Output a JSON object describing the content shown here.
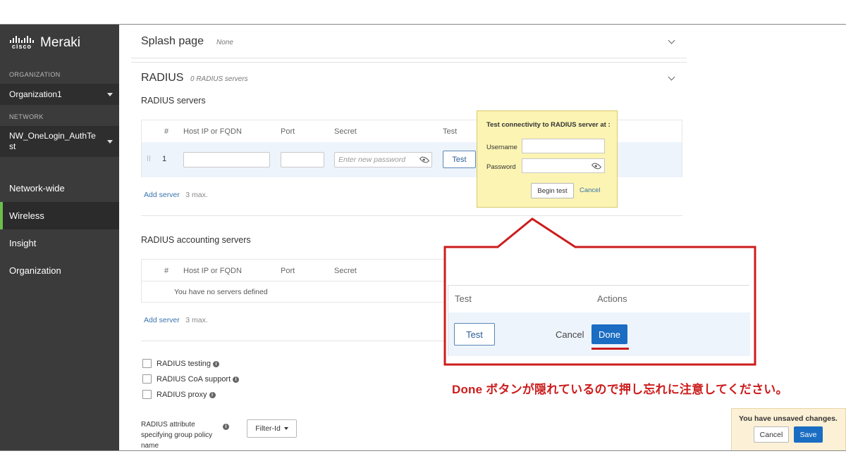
{
  "sidebar": {
    "logo_cisco": "cisco",
    "logo_product": "Meraki",
    "org_label": "ORGANIZATION",
    "org_value": "Organization1",
    "network_label": "NETWORK",
    "network_value": "NW_OneLogin_AuthTest",
    "nav": [
      "Network-wide",
      "Wireless",
      "Insight",
      "Organization"
    ],
    "active_nav": "Wireless",
    "accent": "#6abf4b"
  },
  "splash": {
    "title": "Splash page",
    "value": "None"
  },
  "radius": {
    "title": "RADIUS",
    "count": "0 RADIUS servers",
    "servers_heading": "RADIUS servers",
    "columns": [
      "#",
      "Host IP or FQDN",
      "Port",
      "Secret",
      "Test"
    ],
    "row_number": "1",
    "secret_placeholder": "Enter new password",
    "test_button": "Test",
    "add_server": "Add server",
    "max_note": "3 max.",
    "accounting_heading": "RADIUS accounting servers",
    "accounting_columns": [
      "#",
      "Host IP or FQDN",
      "Port",
      "Secret"
    ],
    "empty_message": "You have no servers defined",
    "options": [
      "RADIUS testing",
      "RADIUS CoA support",
      "RADIUS proxy"
    ],
    "attribute_label": "RADIUS attribute specifying group policy name",
    "attribute_value": "Filter-Id"
  },
  "test_popup": {
    "title": "Test connectivity to RADIUS server at :",
    "username_label": "Username",
    "password_label": "Password",
    "begin_button": "Begin test",
    "cancel_link": "Cancel"
  },
  "callout": {
    "col_test": "Test",
    "col_actions": "Actions",
    "test_button": "Test",
    "cancel_button": "Cancel",
    "done_button": "Done",
    "note": "Done ボタンが隠れているので押し忘れに注意してください。",
    "border_color": "#cc1c1c",
    "done_color": "#1a6dc2"
  },
  "unsaved": {
    "message": "You have unsaved changes.",
    "cancel": "Cancel",
    "save": "Save"
  },
  "icons": [
    "cisco-logo-icon",
    "chevron-down-icon",
    "eye-icon",
    "info-icon",
    "caret-down-icon",
    "drag-handle-icon"
  ]
}
